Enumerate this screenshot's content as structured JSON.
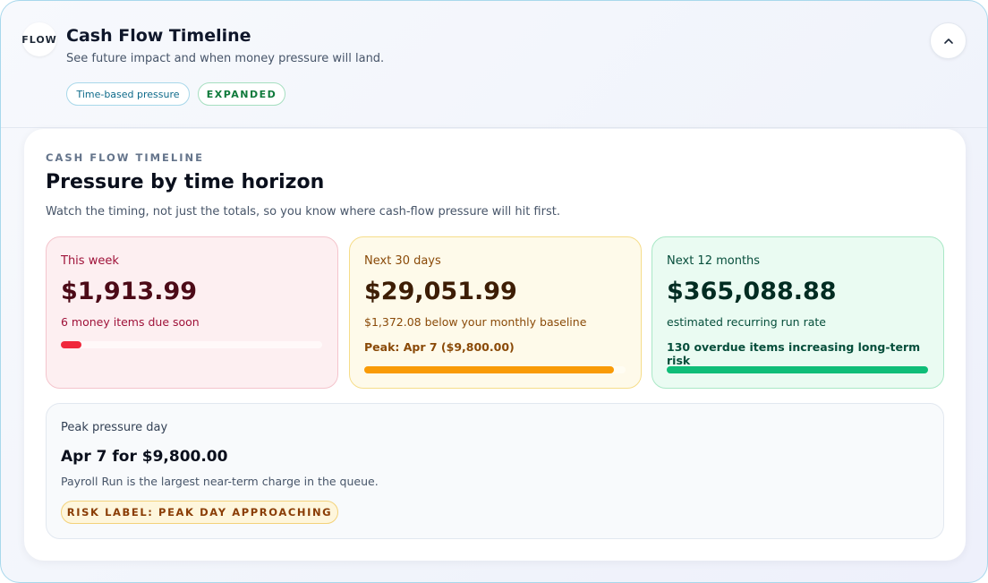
{
  "header": {
    "logo_text": "FLOW",
    "title": "Cash Flow Timeline",
    "subtitle": "See future impact and when money pressure will land.",
    "pills": {
      "time_based": "Time-based pressure",
      "expanded": "EXPANDED"
    },
    "collapse_icon": "chevron-up-icon"
  },
  "main": {
    "eyebrow": "CASH FLOW TIMELINE",
    "heading": "Pressure by time horizon",
    "description": "Watch the timing, not just the totals, so you know where cash-flow pressure will hit first.",
    "this_week": {
      "label": "This week",
      "amount": "$1,913.99",
      "sub": "6 money items due soon",
      "progress": 0.08,
      "color": "#f0283c"
    },
    "next_30": {
      "label": "Next 30 days",
      "amount": "$29,051.99",
      "sub": "$1,372.08 below your monthly baseline",
      "extra": "Peak: Apr 7 ($9,800.00)",
      "progress": 0.955,
      "color": "#f99b07"
    },
    "next_12": {
      "label": "Next 12 months",
      "amount": "$365,088.88",
      "sub": "estimated recurring run rate",
      "extra": "130 overdue items increasing long-term risk",
      "progress": 1.0,
      "color": "#0fbd78"
    },
    "peak": {
      "label": "Peak pressure day",
      "value": "Apr 7 for $9,800.00",
      "note": "Payroll Run is the largest near-term charge in the queue.",
      "risk_label": "RISK LABEL: PEAK DAY APPROACHING"
    }
  }
}
